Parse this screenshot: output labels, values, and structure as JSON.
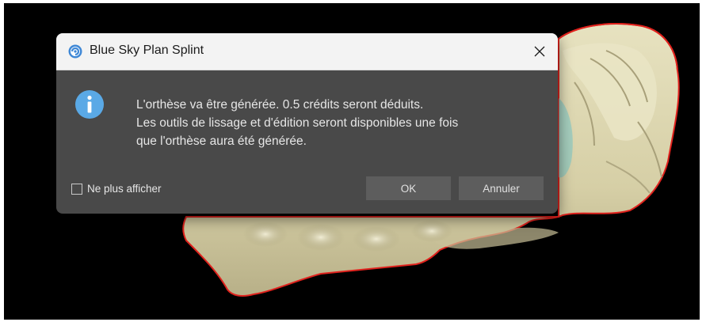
{
  "dialog": {
    "title": "Blue Sky Plan Splint",
    "close_icon": "close-icon",
    "app_icon": "blue-sky-plan-logo-icon",
    "info_icon": "info-icon",
    "message_lines": [
      "L'orthèse va être générée. 0.5 crédits seront déduits.",
      "Les outils de lissage et d'édition seront disponibles une fois",
      "que l'orthèse aura été générée."
    ],
    "checkbox_label": "Ne plus afficher",
    "checkbox_checked": false,
    "ok_label": "OK",
    "cancel_label": "Annuler"
  },
  "colors": {
    "dialog_bg": "#494949",
    "titlebar_bg": "#f3f3f3",
    "button_bg": "#5d5d5d",
    "info_blue": "#5aa9e6",
    "model_outline": "#e0221d",
    "model_surface": "#d9d3ad",
    "viewport_bg": "#000000"
  }
}
